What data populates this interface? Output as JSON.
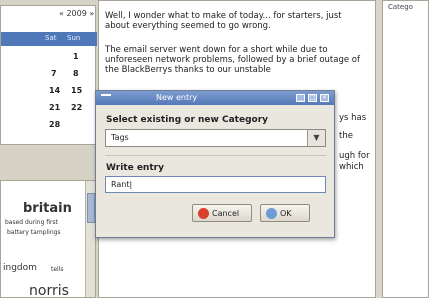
{
  "calendar": {
    "nav": "« 2009 »",
    "headers": [
      "Sat",
      "Sun"
    ],
    "rows": [
      [
        "",
        "1"
      ],
      [
        "7",
        "8"
      ],
      [
        "14",
        "15"
      ],
      [
        "21",
        "22"
      ],
      [
        "28",
        ""
      ]
    ]
  },
  "tagcloud": {
    "tags": [
      "britain",
      "based during first",
      "battery tamplings",
      "ingdom",
      "tells",
      "norris"
    ]
  },
  "editor": {
    "paragraphs": [
      "Well, I wonder what to make of today... for starters, just about everything seemed to go wrong.",
      "The email server went down for a short while due to unforeseen network problems, followed by a brief outage of the BlackBerrys thanks to our unstable"
    ],
    "fragments": [
      "ys has",
      "the",
      "ugh for",
      "which"
    ]
  },
  "right_panel": {
    "header": "Catego"
  },
  "dialog": {
    "title": "New entry",
    "category_label": "Select existing or new Category",
    "category_value": "Tags",
    "entry_label": "Write entry",
    "entry_value": "Rant|",
    "cancel_label": "Cancel",
    "ok_label": "OK",
    "accent": "#5579b8"
  }
}
